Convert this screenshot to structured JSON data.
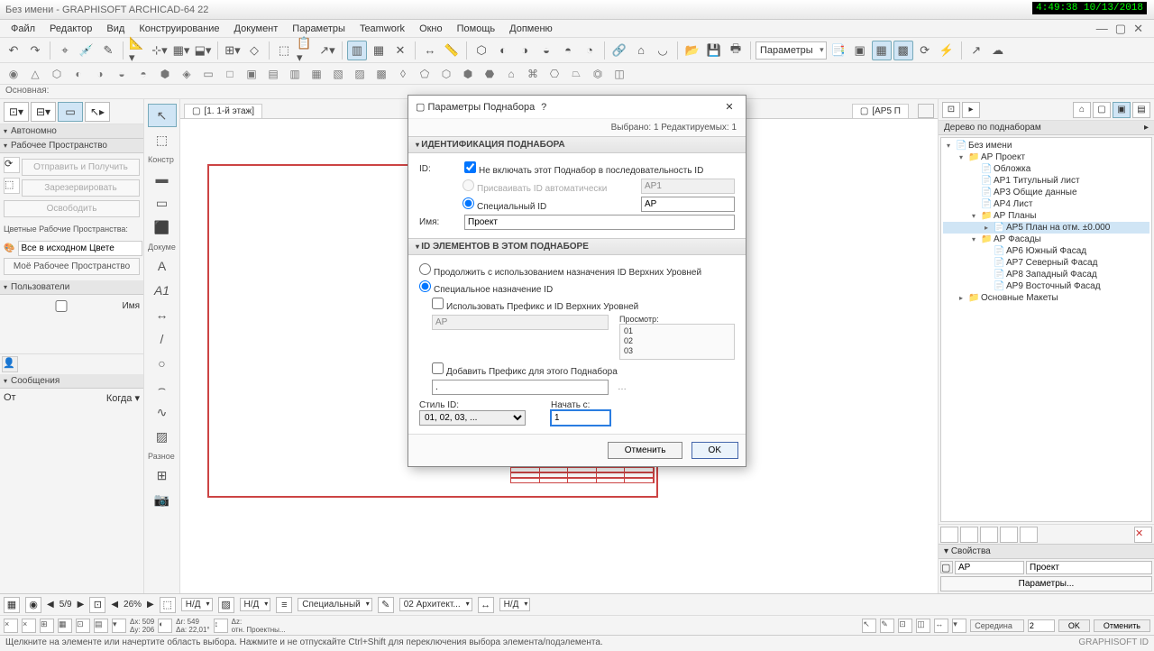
{
  "titlebar": {
    "title": "Без имени - GRAPHISOFT ARCHICAD-64 22",
    "timestamp": "4:49:38  10/13/2018"
  },
  "menu": [
    "Файл",
    "Редактор",
    "Вид",
    "Конструирование",
    "Документ",
    "Параметры",
    "Teamwork",
    "Окно",
    "Помощь",
    "Допменю"
  ],
  "toolbar": {
    "params_label": "Параметры"
  },
  "status_label": "Основная:",
  "left": {
    "teamwork_hd": "Автономно",
    "workspace_hd": "Рабочее Пространство",
    "send_receive": "Отправить и Получить",
    "reserve": "Зарезервировать",
    "release": "Освободить",
    "color_ws": "Цветные Рабочие Пространства:",
    "all_source": "Все в исходном Цвете",
    "my_ws": "Моё Рабочее Пространство",
    "users_hd": "Пользователи",
    "user_name": "Имя",
    "messages_hd": "Сообщения",
    "from": "От",
    "when": "Когда"
  },
  "toolbox": {
    "cat1": "Констр",
    "cat2": "Докуме",
    "cat3": "Разное"
  },
  "tabs": {
    "tab1": "[1. 1-й этаж]",
    "tab2": "[АР5 П"
  },
  "navigator": {
    "header": "Дерево по поднаборам",
    "items": [
      {
        "depth": 0,
        "exp": "▾",
        "ico": "📄",
        "label": "Без имени"
      },
      {
        "depth": 1,
        "exp": "▾",
        "ico": "📁",
        "label": "АР Проект"
      },
      {
        "depth": 2,
        "exp": "",
        "ico": "📄",
        "label": "Обложка"
      },
      {
        "depth": 2,
        "exp": "",
        "ico": "📄",
        "label": "АР1 Титульный лист"
      },
      {
        "depth": 2,
        "exp": "",
        "ico": "📄",
        "label": "АР3 Общие данные"
      },
      {
        "depth": 2,
        "exp": "",
        "ico": "📄",
        "label": "АР4 Лист"
      },
      {
        "depth": 2,
        "exp": "▾",
        "ico": "📁",
        "label": "АР Планы"
      },
      {
        "depth": 3,
        "exp": "▸",
        "ico": "📄",
        "label": "АР5 План на отм. ±0.000",
        "sel": true
      },
      {
        "depth": 2,
        "exp": "▾",
        "ico": "📁",
        "label": "АР Фасады"
      },
      {
        "depth": 3,
        "exp": "",
        "ico": "📄",
        "label": "АР6 Южный Фасад"
      },
      {
        "depth": 3,
        "exp": "",
        "ico": "📄",
        "label": "АР7 Северный Фасад"
      },
      {
        "depth": 3,
        "exp": "",
        "ico": "📄",
        "label": "АР8 Западный Фасад"
      },
      {
        "depth": 3,
        "exp": "",
        "ico": "📄",
        "label": "АР9 Восточный Фасад"
      },
      {
        "depth": 1,
        "exp": "▸",
        "ico": "📁",
        "label": "Основные Макеты"
      }
    ],
    "props_hd": "Свойства",
    "prop_id": "АР",
    "prop_name": "Проект",
    "params_btn": "Параметры..."
  },
  "botbar": {
    "pages": "5/9",
    "zoom": "26%",
    "nd1": "Н/Д",
    "nd2": "Н/Д",
    "spec": "Специальный",
    "arch": "02 Архитект...",
    "nd3": "Н/Д"
  },
  "botbar2": {
    "dx": "Δx: 509",
    "dy": "Δy: 206",
    "dr": "Δr: 549",
    "da": "Δa: 22,01°",
    "dz": "Δz:",
    "otn": "отн. Проектны...",
    "mid": "Середина",
    "num": "2",
    "ok": "OK",
    "cancel": "Отменить"
  },
  "statusbar": {
    "hint": "Щелкните на элементе или начертите область выбора. Нажмите и не отпускайте Ctrl+Shift для переключения выбора элемента/подэлемента.",
    "brand": "GRAPHISOFT ID"
  },
  "dialog": {
    "title": "Параметры Поднабора",
    "selection": "Выбрано: 1 Редактируемых: 1",
    "sec1": "ИДЕНТИФИКАЦИЯ ПОДНАБОРА",
    "id_label": "ID:",
    "exclude": "Не включать этот Поднабор в последовательность ID",
    "auto_id": "Присваивать ID автоматически",
    "auto_val": "АР1",
    "custom_id": "Специальный ID",
    "custom_val": "АР",
    "name_label": "Имя:",
    "name_val": "Проект",
    "sec2": "ID ЭЛЕМЕНТОВ В ЭТОМ ПОДНАБОРЕ",
    "continue": "Продолжить с использованием назначения ID Верхних Уровней",
    "special_assign": "Специальное назначение ID",
    "use_prefix": "Использовать Префикс и ID Верхних Уровней",
    "prefix_val": "АР",
    "preview_label": "Просмотр:",
    "preview_lines": "01\n02\n03",
    "add_prefix": "Добавить Префикс для этого Поднабора",
    "add_prefix_val": ".",
    "style_label": "Стиль ID:",
    "style_val": "01, 02, 03, ...",
    "start_label": "Начать с:",
    "start_val": "1",
    "cancel": "Отменить",
    "ok": "OK"
  }
}
